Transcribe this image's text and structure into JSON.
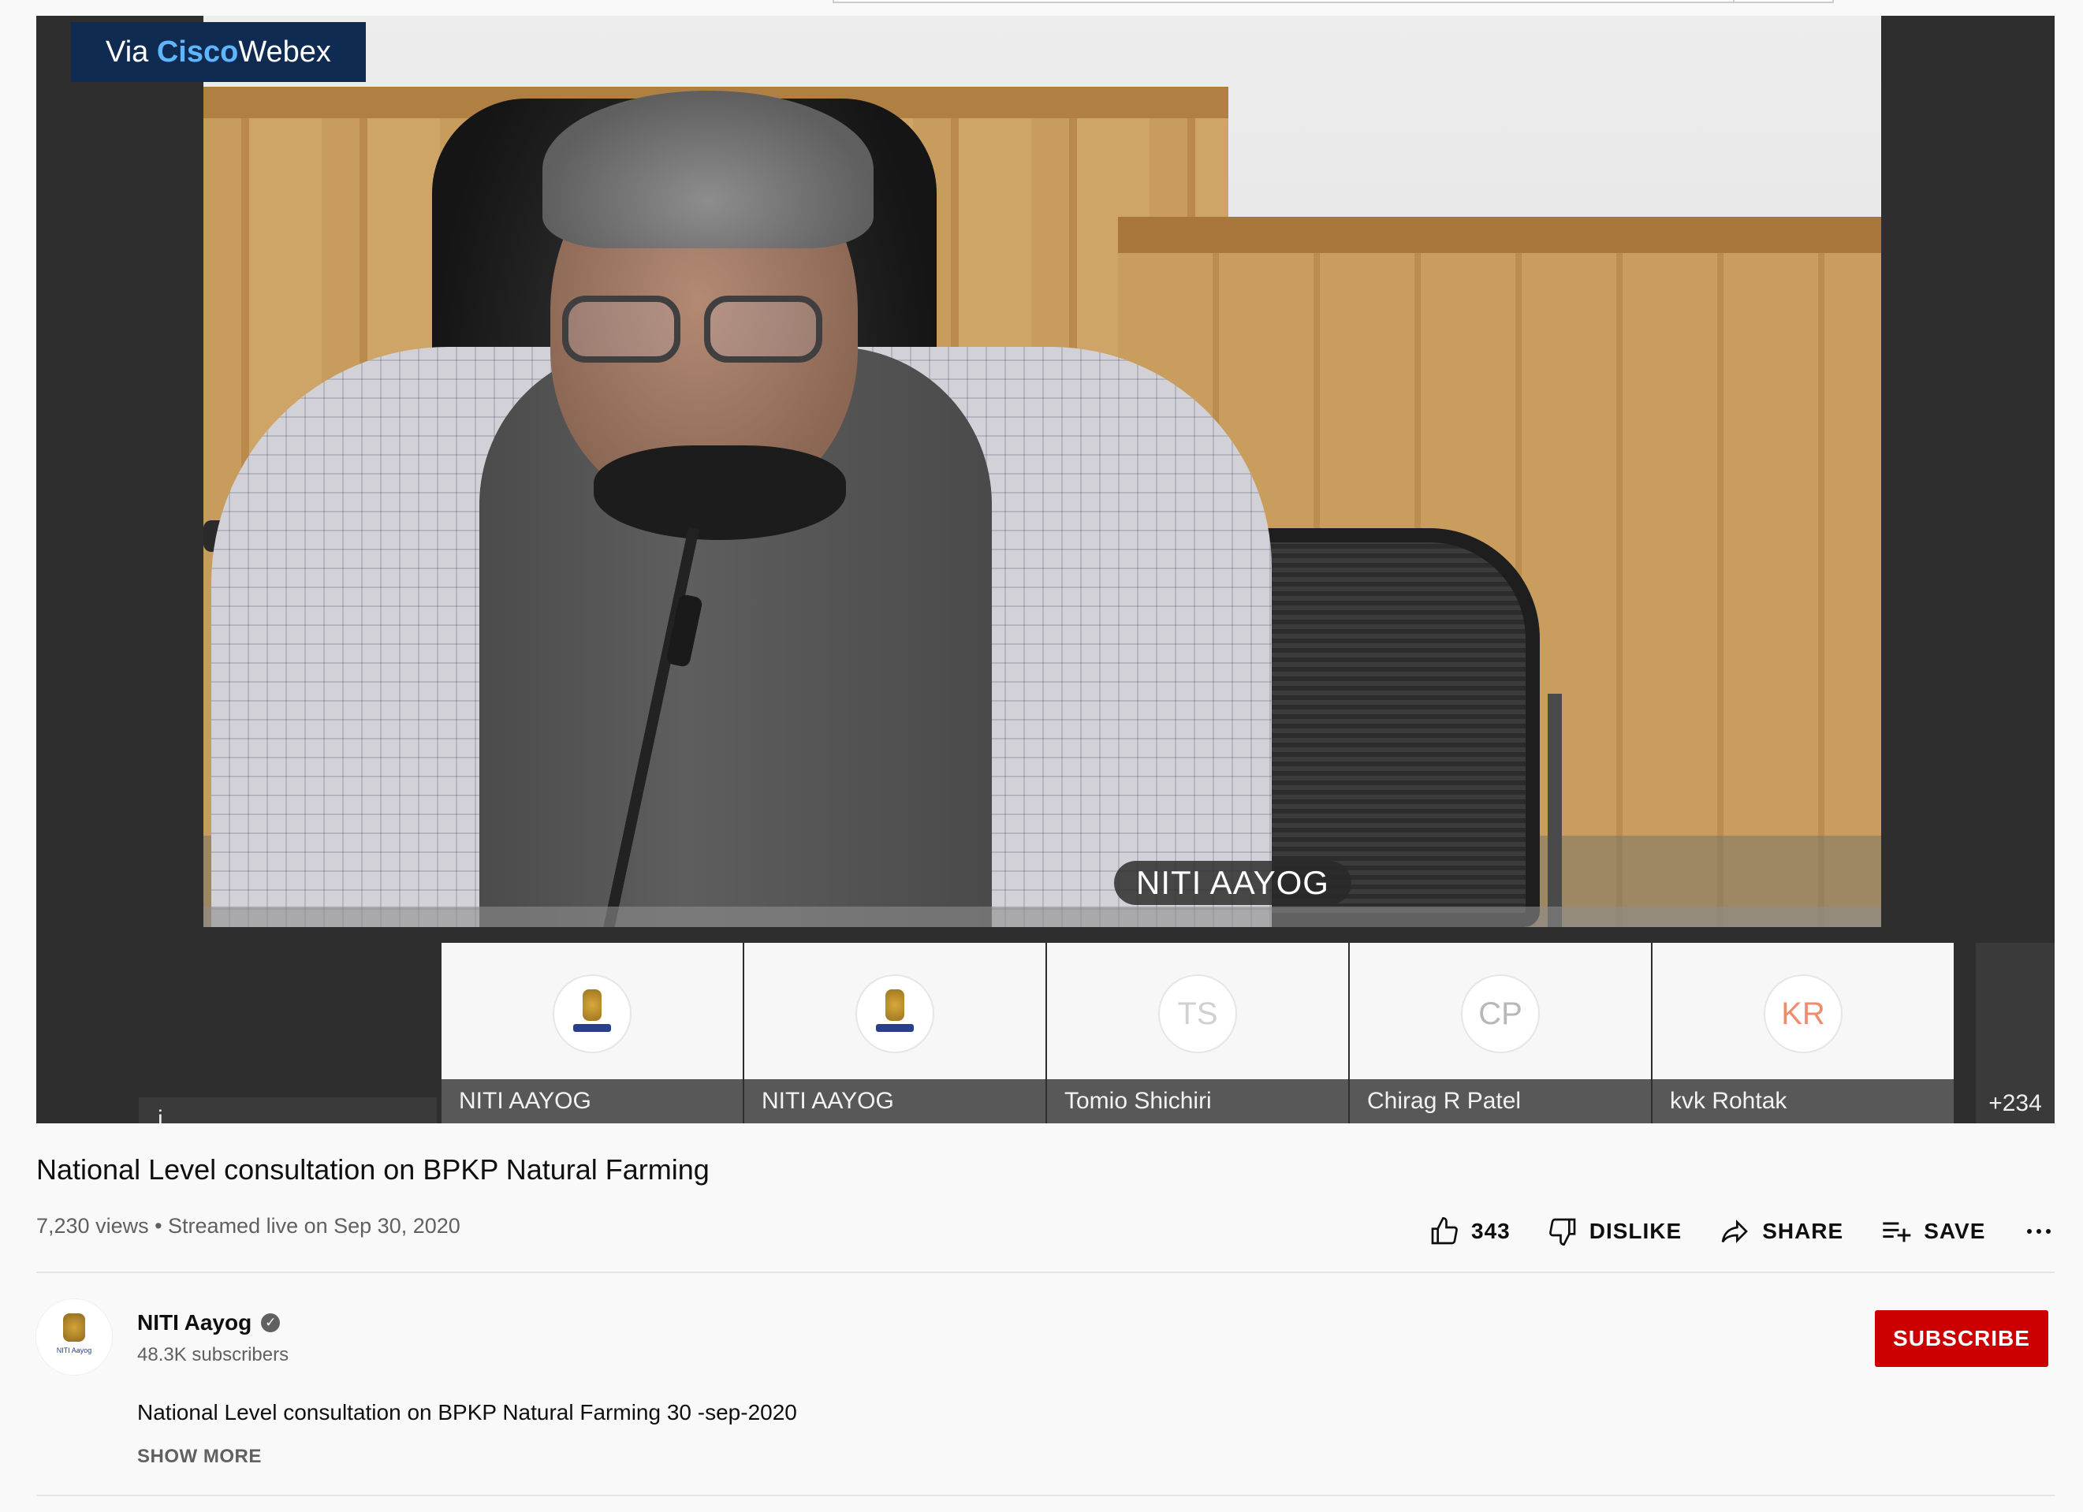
{
  "video": {
    "badge_prefix": "Via",
    "badge_brand": "Cisco",
    "badge_product": "Webex",
    "speaker_label": "NITI AAYOG",
    "participants": [
      {
        "initials": "",
        "name": "NITI AAYOG",
        "avatar": "emblem",
        "color": "#d8a93a"
      },
      {
        "initials": "",
        "name": "NITI AAYOG",
        "avatar": "emblem",
        "color": "#d8a93a"
      },
      {
        "initials": "TS",
        "name": "Tomio Shichiri",
        "avatar": "initials",
        "color": "#d0d0d0"
      },
      {
        "initials": "CP",
        "name": "Chirag R Patel",
        "avatar": "initials",
        "color": "#b8b8b8"
      },
      {
        "initials": "KR",
        "name": "kvk Rohtak",
        "avatar": "initials",
        "color": "#f08a70"
      }
    ],
    "left_tile_label": "i",
    "more_count": "+234"
  },
  "info": {
    "title": "National Level consultation on BPKP Natural Farming",
    "meta": "7,230 views • Streamed live on Sep 30, 2020",
    "actions": {
      "like_count": "343",
      "dislike_label": "DISLIKE",
      "share_label": "SHARE",
      "save_label": "SAVE"
    }
  },
  "channel": {
    "name": "NITI Aayog",
    "subscribers": "48.3K subscribers",
    "avatar_text": "NITI Aayog",
    "subscribe_label": "SUBSCRIBE",
    "description": "National Level consultation on BPKP Natural Farming 30 -sep-2020",
    "show_more_label": "SHOW MORE"
  },
  "icons": {
    "like": "thumbs-up-icon",
    "dislike": "thumbs-down-icon",
    "share": "share-arrow-icon",
    "save": "playlist-add-icon",
    "more": "more-horizontal-icon",
    "verified": "verified-check-icon"
  },
  "colors": {
    "subscribe": "#cc0000",
    "page_bg": "#f9f9f9",
    "webex_badge": "#102b52"
  }
}
